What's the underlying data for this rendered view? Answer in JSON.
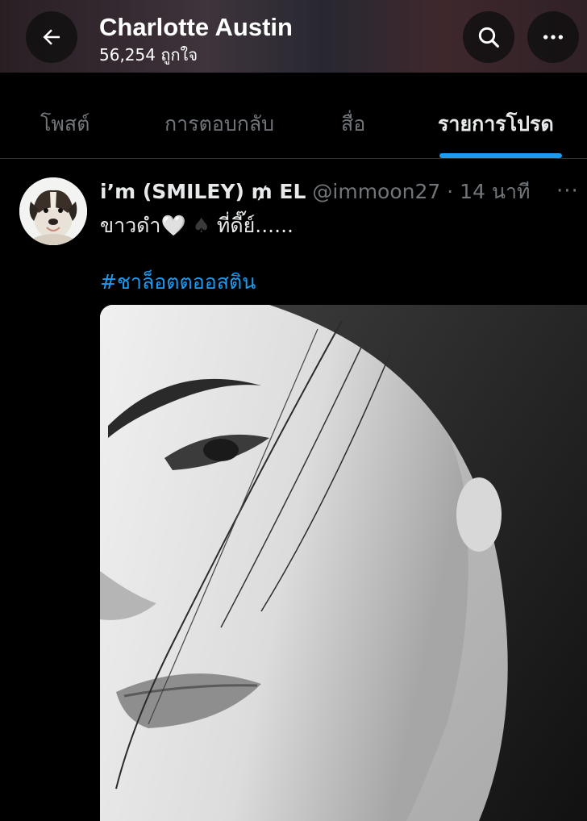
{
  "header": {
    "title": "Charlotte Austin",
    "subtitle": "56,254 ถูกใจ",
    "back_icon": "arrow-left-icon",
    "search_icon": "search-icon",
    "more_icon": "more-horizontal-icon"
  },
  "tabs": [
    {
      "label": "โพสต์",
      "active": false
    },
    {
      "label": "การตอบกลับ",
      "active": false
    },
    {
      "label": "สื่อ",
      "active": false
    },
    {
      "label": "รายการโปรด",
      "active": true
    }
  ],
  "accent_color": "#1d9bf0",
  "post": {
    "display_name": "i’m (SMILEY) ₥ EL",
    "handle": "@immoon27",
    "separator": " · ",
    "time": "14 นาที",
    "text_before": "ขาวดำ",
    "heart_emoji": "🤍",
    "spade_emoji": "♠",
    "text_after": "ที่ดี๊ย์......",
    "hashtag": "#ชาล็อตตออสติน",
    "more": "···"
  }
}
